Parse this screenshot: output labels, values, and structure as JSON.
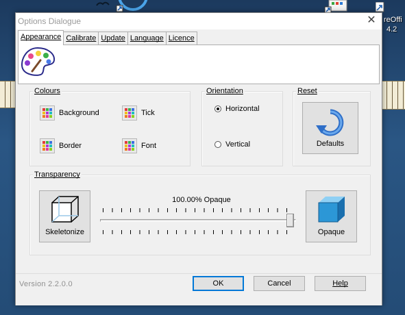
{
  "desktop": {
    "right_label_lines": [
      "reOffi",
      "4.2"
    ]
  },
  "dialog": {
    "title": "Options Dialogue",
    "tabs": [
      {
        "label": "Appearance",
        "active": true
      },
      {
        "label": "Calibrate",
        "active": false
      },
      {
        "label": "Update",
        "active": false
      },
      {
        "label": "Language",
        "active": false
      },
      {
        "label": "Licence",
        "active": false
      }
    ],
    "tab_icon": "palette-icon",
    "colours": {
      "label": "Colours",
      "items": [
        "Background",
        "Tick",
        "Border",
        "Font"
      ]
    },
    "orientation": {
      "label": "Orientation",
      "options": [
        "Horizontal",
        "Vertical"
      ],
      "selected": "Horizontal"
    },
    "reset": {
      "label": "Reset",
      "button": "Defaults"
    },
    "transparency": {
      "label": "Transparency",
      "left_button": "Skeletonize",
      "right_button": "Opaque",
      "value_text": "100.00% Opaque",
      "value_fraction": 1.0
    },
    "version": "Version  2.2.0.0",
    "buttons": {
      "ok": "OK",
      "cancel": "Cancel",
      "help": "Help"
    },
    "colors": {
      "accent": "#0078d7",
      "face": "#f0f0f0"
    }
  }
}
